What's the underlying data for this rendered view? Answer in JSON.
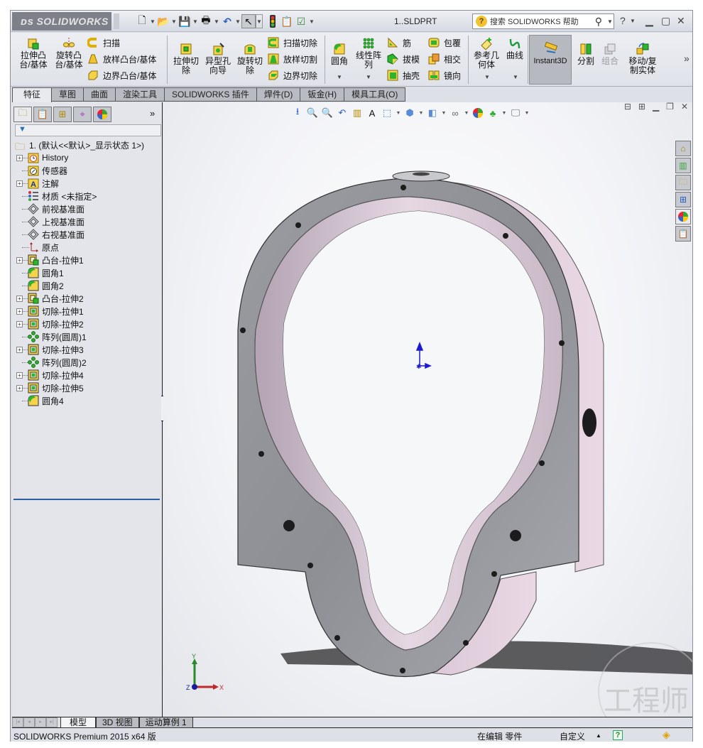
{
  "titlebar": {
    "logo": "SOLIDWORKS",
    "document_title": "1..SLDPRT",
    "help_search_placeholder": "搜索 SOLIDWORKS 帮助",
    "quick_access": [
      "new-document-icon",
      "open-icon",
      "save-icon",
      "print-icon",
      "undo-icon",
      "select-icon",
      "rebuild-icon",
      "file-properties-icon",
      "options-icon"
    ]
  },
  "commands": {
    "extruded_boss": "拉伸凸\n台/基体",
    "revolved_boss": "旋转凸\n台/基体",
    "sweep": "扫描",
    "loft": "放样凸台/基体",
    "boundary_boss": "边界凸台/基体",
    "extruded_cut": "拉伸切\n除",
    "hole_wizard": "异型孔\n向导",
    "revolved_cut": "旋转切\n除",
    "swept_cut": "扫描切除",
    "lofted_cut": "放样切割",
    "boundary_cut": "边界切除",
    "fillet": "圆角",
    "linear_pattern": "线性阵\n列",
    "rib": "筋",
    "draft": "拔模",
    "shell": "抽壳",
    "wrap": "包覆",
    "intersect": "相交",
    "mirror": "镜向",
    "reference_geometry": "参考几\n何体",
    "curves": "曲线",
    "instant3d": "Instant3D",
    "split": "分割",
    "combine": "组合",
    "move_copy": "移动/复\n制实体",
    "more": "»"
  },
  "tabs": [
    "特征",
    "草图",
    "曲面",
    "渲染工具",
    "SOLIDWORKS 插件",
    "焊件(D)",
    "钣金(H)",
    "模具工具(O)"
  ],
  "active_tab": "特征",
  "panel": {
    "tabs": [
      "featuremanager-icon",
      "propertymanager-icon",
      "configurationmanager-icon",
      "dimxpert-icon",
      "display-manager-icon"
    ],
    "more": "»",
    "filter_icon": "filter-icon",
    "root": "1.  (默认<<默认>_显示状态 1>)",
    "tree": [
      {
        "label": "History",
        "icon": "history-icon",
        "expandable": true
      },
      {
        "label": "传感器",
        "icon": "sensor-icon",
        "expandable": false
      },
      {
        "label": "注解",
        "icon": "annotations-icon",
        "expandable": true
      },
      {
        "label": "材质 <未指定>",
        "icon": "material-icon",
        "expandable": false
      },
      {
        "label": "前视基准面",
        "icon": "plane-icon",
        "expandable": false
      },
      {
        "label": "上视基准面",
        "icon": "plane-icon",
        "expandable": false
      },
      {
        "label": "右视基准面",
        "icon": "plane-icon",
        "expandable": false
      },
      {
        "label": "原点",
        "icon": "origin-icon",
        "expandable": false
      },
      {
        "label": "凸台-拉伸1",
        "icon": "boss-extrude-icon",
        "expandable": true
      },
      {
        "label": "圆角1",
        "icon": "fillet-icon",
        "expandable": false
      },
      {
        "label": "圆角2",
        "icon": "fillet-icon",
        "expandable": false
      },
      {
        "label": "凸台-拉伸2",
        "icon": "boss-extrude-icon",
        "expandable": true
      },
      {
        "label": "切除-拉伸1",
        "icon": "cut-extrude-icon",
        "expandable": true
      },
      {
        "label": "切除-拉伸2",
        "icon": "cut-extrude-icon",
        "expandable": true
      },
      {
        "label": "阵列(圆周)1",
        "icon": "circular-pattern-icon",
        "expandable": false
      },
      {
        "label": "切除-拉伸3",
        "icon": "cut-extrude-icon",
        "expandable": true
      },
      {
        "label": "阵列(圆周)2",
        "icon": "circular-pattern-icon",
        "expandable": false
      },
      {
        "label": "切除-拉伸4",
        "icon": "cut-extrude-icon",
        "expandable": true
      },
      {
        "label": "切除-拉伸5",
        "icon": "cut-extrude-icon",
        "expandable": true
      },
      {
        "label": "圆角4",
        "icon": "fillet-icon",
        "expandable": false
      }
    ]
  },
  "viewport": {
    "triad": {
      "x": "X",
      "y": "Y",
      "z": "Z"
    },
    "watermark": "工程师"
  },
  "bottom_tabs": [
    "模型",
    "3D 视图",
    "运动算例 1"
  ],
  "active_bottom_tab": "模型",
  "status": {
    "product": "SOLIDWORKS Premium 2015 x64 版",
    "mode": "在编辑 零件",
    "units": "自定义",
    "units_arrow": "▲"
  },
  "colors": {
    "accent": "#2c5f9e",
    "part_face": "#d9c9d6",
    "part_edge": "#8a8c92"
  }
}
